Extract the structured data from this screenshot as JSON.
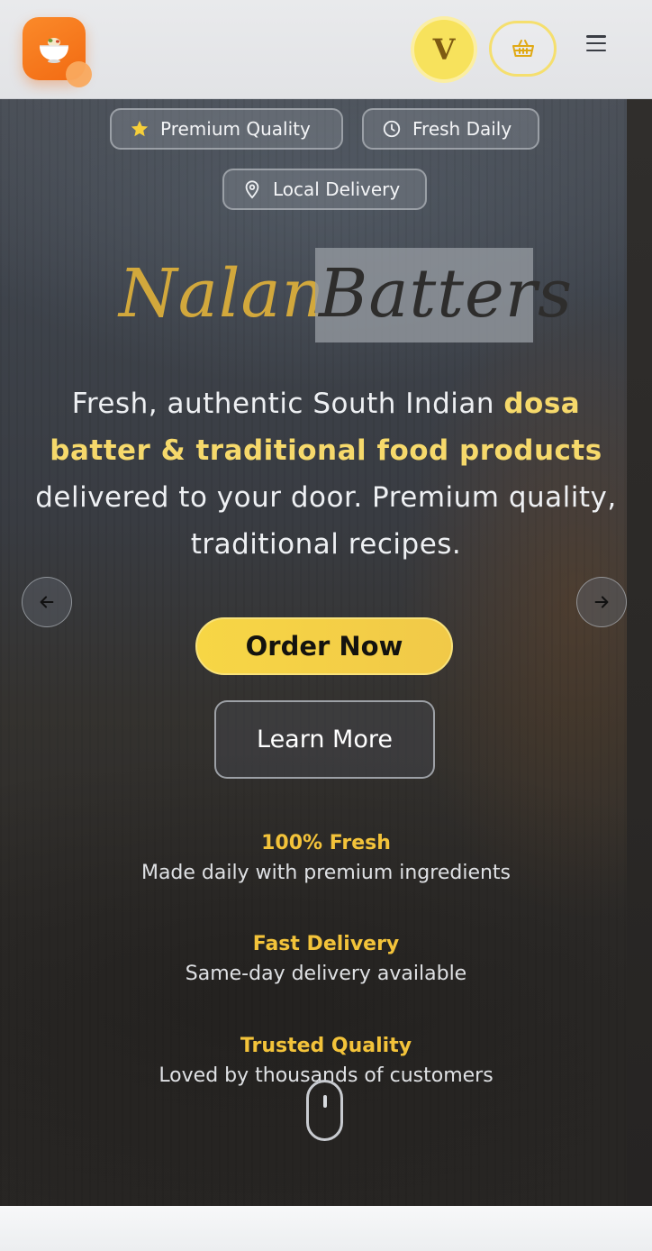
{
  "header": {
    "avatar_letter": "V",
    "logo_icon": "food-bowl-icon",
    "cart_icon": "basket-icon",
    "menu_icon": "hamburger-menu-icon"
  },
  "badges": [
    {
      "label": "Premium Quality",
      "icon": "star-icon"
    },
    {
      "label": "Fresh Daily",
      "icon": "clock-icon"
    },
    {
      "label": "Local Delivery",
      "icon": "map-pin-icon"
    }
  ],
  "hero": {
    "title_part1": "Nalan",
    "title_part2": "Batters",
    "tagline_start": "Fresh, authentic South Indian ",
    "tagline_highlight": "dosa batter & traditional food products",
    "tagline_end": " delivered to your door. Premium quality, traditional recipes.",
    "order_button": "Order Now",
    "learn_button": "Learn More"
  },
  "features": [
    {
      "title": "100% Fresh",
      "desc": "Made daily with premium ingredients"
    },
    {
      "title": "Fast Delivery",
      "desc": "Same-day delivery available"
    },
    {
      "title": "Trusted Quality",
      "desc": "Loved by thousands of customers"
    }
  ],
  "colors": {
    "accent": "#f3c33a",
    "brand_orange": "#f47a1e",
    "title_gold": "#d2a83c"
  }
}
